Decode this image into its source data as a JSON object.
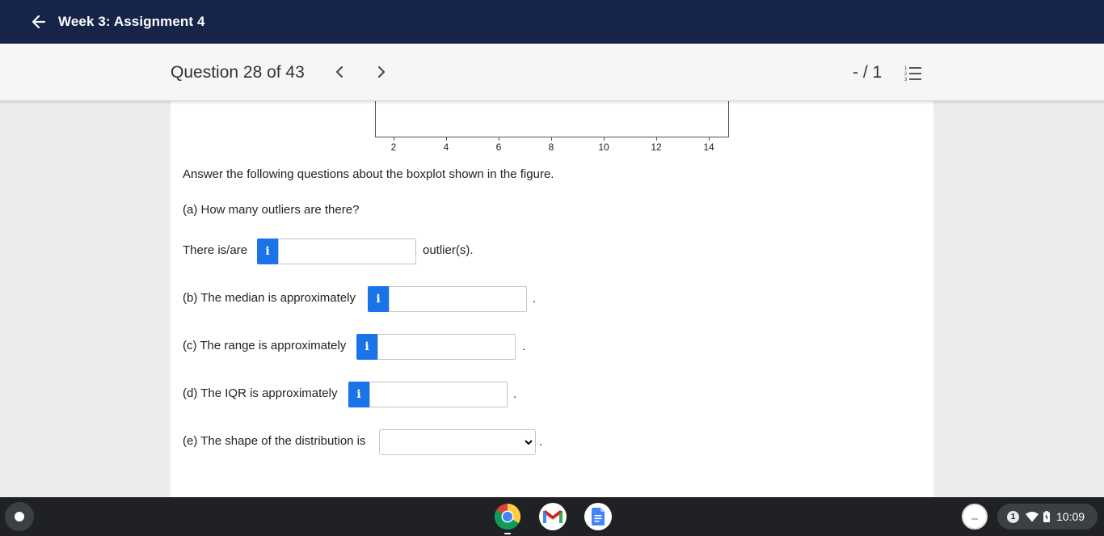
{
  "header": {
    "title": "Week 3: Assignment 4"
  },
  "question_bar": {
    "question_label": "Question 28 of 43",
    "score": "- / 1"
  },
  "chart_data": {
    "type": "boxplot",
    "xticks": [
      "2",
      "4",
      "6",
      "8",
      "10",
      "12",
      "14"
    ]
  },
  "content": {
    "intro": "Answer the following questions about the boxplot shown in the figure.",
    "part_a_question": "(a) How many outliers are there?",
    "part_a_prefix": "There is/are",
    "part_a_suffix": "outlier(s).",
    "part_b_label": "(b) The median is approximately",
    "part_c_label": "(c) The range is approximately",
    "part_d_label": "(d) The IQR is approximately",
    "part_e_label": "(e) The shape of the distribution is",
    "period": ".",
    "info_glyph": "i",
    "shape_selected": ""
  },
  "shelf": {
    "tray_badge": "1",
    "time": "10:09"
  }
}
